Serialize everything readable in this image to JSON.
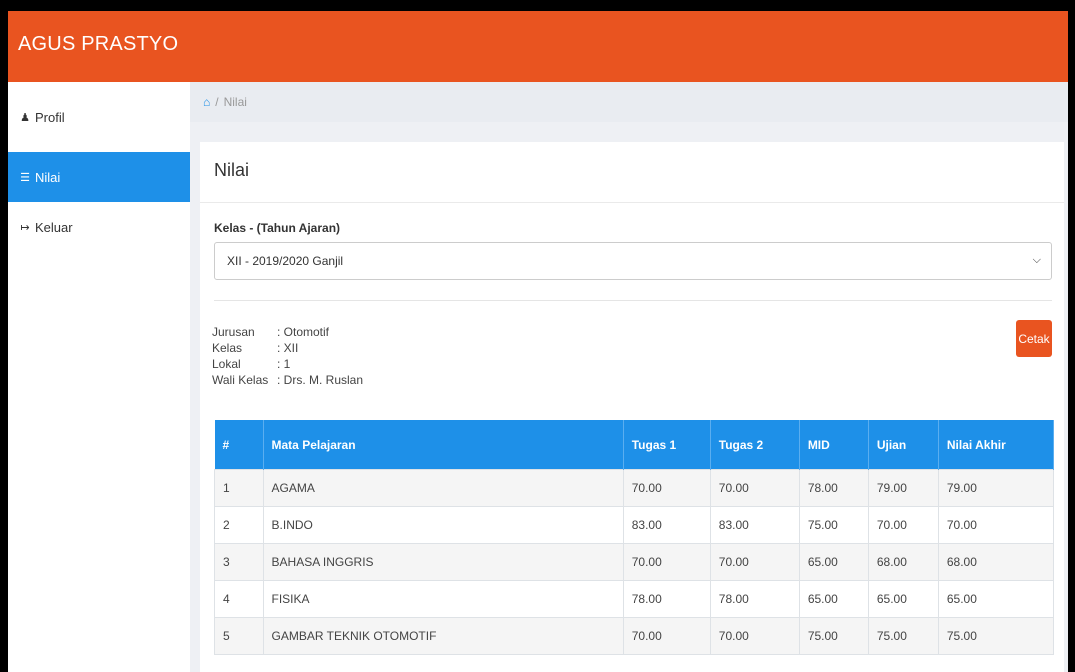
{
  "brand": "AGUS PRASTYO",
  "colors": {
    "accent": "#e95420",
    "primary": "#1e90e8"
  },
  "sidebar": {
    "items": [
      {
        "label": "Profil",
        "icon": "user-icon",
        "glyph": "♟"
      },
      {
        "label": "Nilai",
        "icon": "list-icon",
        "glyph": "☰"
      },
      {
        "label": "Keluar",
        "icon": "sign-out-icon",
        "glyph": "↦"
      }
    ]
  },
  "breadcrumb": {
    "home_icon": "home-icon",
    "separator": "/",
    "current": "Nilai"
  },
  "panel": {
    "title": "Nilai",
    "select_label": "Kelas - (Tahun Ajaran)",
    "select_value": "XII - 2019/2020 Ganjil",
    "info": [
      {
        "key": "Jurusan",
        "value": ": Otomotif"
      },
      {
        "key": "Kelas",
        "value": ": XII"
      },
      {
        "key": "Lokal",
        "value": ": 1"
      },
      {
        "key": "Wali Kelas",
        "value": ": Drs. M. Ruslan"
      }
    ],
    "print_button": "Cetak"
  },
  "table": {
    "headers": [
      "#",
      "Mata Pelajaran",
      "Tugas 1",
      "Tugas 2",
      "MID",
      "Ujian",
      "Nilai Akhir"
    ],
    "rows": [
      [
        "1",
        "AGAMA",
        "70.00",
        "70.00",
        "78.00",
        "79.00",
        "79.00"
      ],
      [
        "2",
        "B.INDO",
        "83.00",
        "83.00",
        "75.00",
        "70.00",
        "70.00"
      ],
      [
        "3",
        "BAHASA INGGRIS",
        "70.00",
        "70.00",
        "65.00",
        "68.00",
        "68.00"
      ],
      [
        "4",
        "FISIKA",
        "78.00",
        "78.00",
        "65.00",
        "65.00",
        "65.00"
      ],
      [
        "5",
        "GAMBAR TEKNIK OTOMOTIF",
        "70.00",
        "70.00",
        "75.00",
        "75.00",
        "75.00"
      ]
    ]
  }
}
